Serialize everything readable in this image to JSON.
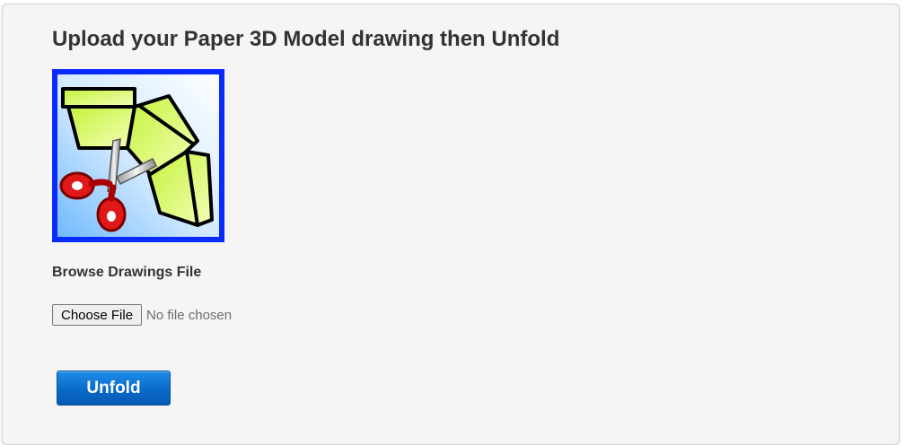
{
  "page": {
    "title": "Upload your Paper 3D Model drawing then Unfold"
  },
  "logo": {
    "icon": "paper-model-scissors-icon",
    "border_color": "#0a2bff",
    "background_gradient": [
      "#ffffff",
      "#7ec3ff"
    ],
    "shape_fill": "#d8ff5a"
  },
  "upload": {
    "label": "Browse Drawings File",
    "choose_button_label": "Choose File",
    "status_text": "No file chosen"
  },
  "actions": {
    "unfold_label": "Unfold",
    "unfold_color": "#0a69c9"
  }
}
